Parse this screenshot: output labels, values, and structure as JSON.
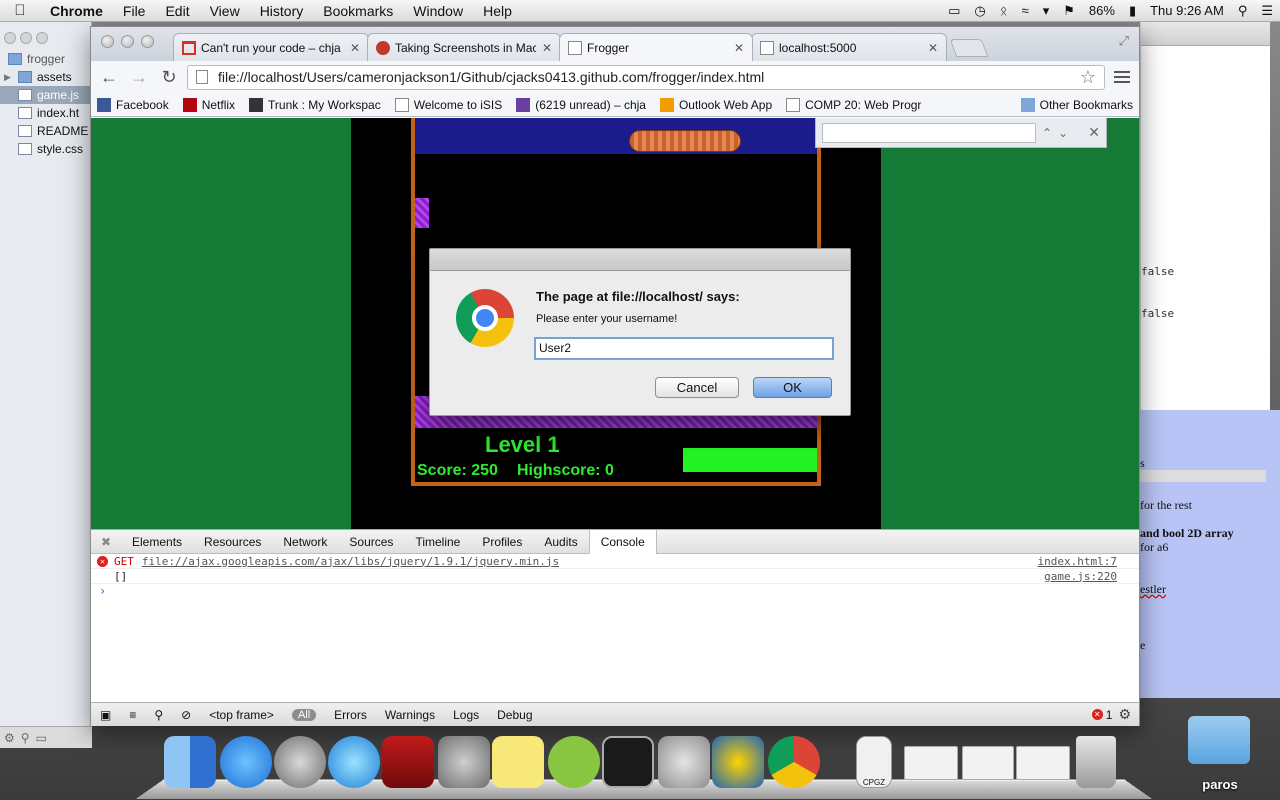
{
  "menubar": {
    "app": "Chrome",
    "items": [
      "File",
      "Edit",
      "View",
      "History",
      "Bookmarks",
      "Window",
      "Help"
    ],
    "battery": "86%",
    "clock": "Thu 9:26 AM"
  },
  "finder": {
    "title": "frogger",
    "rows": [
      {
        "name": "assets",
        "kind": "folder",
        "selected": false
      },
      {
        "name": "game.js",
        "kind": "file",
        "selected": true
      },
      {
        "name": "index.ht",
        "kind": "file",
        "selected": false
      },
      {
        "name": "README",
        "kind": "file",
        "selected": false
      },
      {
        "name": "style.css",
        "kind": "file",
        "selected": false
      }
    ]
  },
  "bg_right": {
    "code_lines": [
      "false",
      "false"
    ],
    "doc_lines": [
      "s",
      "for the rest",
      "and bool 2D array",
      "for a6",
      "estler",
      "e"
    ]
  },
  "chrome": {
    "tabs": [
      {
        "title": "Can't run your code – chja",
        "favicon": "gmail-icon"
      },
      {
        "title": "Taking Screenshots in Mac",
        "favicon": "apple-icon"
      },
      {
        "title": "Frogger",
        "favicon": "page-icon"
      },
      {
        "title": "localhost:5000",
        "favicon": "page-icon"
      }
    ],
    "active_tab_index": 2,
    "url": "file://localhost/Users/cameronjackson1/Github/cjacks0413.github.com/frogger/index.html",
    "bookmarks": [
      {
        "label": "Facebook",
        "icon": "facebook-icon",
        "color": "#3b5998"
      },
      {
        "label": "Netflix",
        "icon": "netflix-icon",
        "color": "#b20710"
      },
      {
        "label": "Trunk : My Workspac",
        "icon": "trunk-icon",
        "color": "#333333"
      },
      {
        "label": "Welcome to iSIS",
        "icon": "page-icon",
        "color": "#ffffff"
      },
      {
        "label": "(6219 unread) – chja",
        "icon": "mail-icon",
        "color": "#6a3fa0"
      },
      {
        "label": "Outlook Web App",
        "icon": "outlook-icon",
        "color": "#f29c00"
      },
      {
        "label": "COMP 20: Web Progr",
        "icon": "page-icon",
        "color": "#ffffff"
      }
    ],
    "other_bookmarks": "Other Bookmarks"
  },
  "game": {
    "level_text": "Level 1",
    "score_text": "Score: 250",
    "highscore_text": "Highscore: 0",
    "colors": {
      "text": "#2eeb2e",
      "border": "#c5621a",
      "grass": "#157a35"
    }
  },
  "dialog": {
    "title": "The page at file://localhost/ says:",
    "message": "Please enter your username!",
    "input_value": "User2",
    "cancel_label": "Cancel",
    "ok_label": "OK"
  },
  "devtools": {
    "tabs": [
      "Elements",
      "Resources",
      "Network",
      "Sources",
      "Timeline",
      "Profiles",
      "Audits",
      "Console"
    ],
    "active_tab": "Console",
    "console": [
      {
        "level": "error",
        "method": "GET",
        "url": "file://ajax.googleapis.com/ajax/libs/jquery/1.9.1/jquery.min.js",
        "source": "index.html:7"
      },
      {
        "level": "log",
        "text": "[]",
        "source": "game.js:220"
      }
    ],
    "status": {
      "frame": "<top frame>",
      "filters": [
        "All",
        "Errors",
        "Warnings",
        "Logs",
        "Debug"
      ],
      "error_count": "1"
    }
  },
  "dock": {
    "items": [
      "finder-icon",
      "app-store-icon",
      "launchpad-icon",
      "itunes-icon",
      "photo-booth-icon",
      "system-preferences-icon",
      "stickies-icon",
      "spotify-icon",
      "terminal-icon",
      "preview-icon",
      "wolfram-icon",
      "chrome-icon",
      "cpgz-file-icon",
      "window-thumb-icon",
      "window-thumb-icon",
      "window-thumb-icon",
      "trash-icon"
    ],
    "cpgz_label": "CPGZ",
    "desktop_folder": "paros"
  }
}
